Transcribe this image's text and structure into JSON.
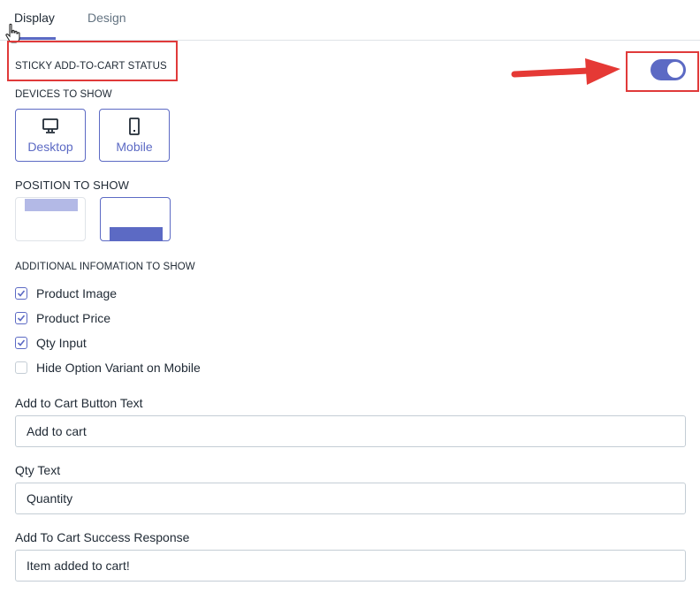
{
  "tabs": [
    {
      "label": "Display",
      "active": true
    },
    {
      "label": "Design",
      "active": false
    }
  ],
  "status": {
    "heading": "STICKY ADD-TO-CART STATUS",
    "enabled": true
  },
  "devices": {
    "heading": "DEVICES TO SHOW",
    "options": [
      {
        "label": "Desktop",
        "icon": "desktop-icon",
        "selected": true
      },
      {
        "label": "Mobile",
        "icon": "mobile-icon",
        "selected": true
      }
    ]
  },
  "position": {
    "heading": "POSITION TO SHOW",
    "options": [
      {
        "value": "top",
        "selected": false
      },
      {
        "value": "bottom",
        "selected": true
      }
    ]
  },
  "additional_info": {
    "heading": "ADDITIONAL INFOMATION TO SHOW",
    "options": [
      {
        "label": "Product Image",
        "checked": true
      },
      {
        "label": "Product Price",
        "checked": true
      },
      {
        "label": "Qty Input",
        "checked": true
      },
      {
        "label": "Hide Option Variant on Mobile",
        "checked": false
      }
    ]
  },
  "fields": [
    {
      "label": "Add to Cart Button Text",
      "value": "Add to cart"
    },
    {
      "label": "Qty Text",
      "value": "Quantity"
    },
    {
      "label": "Add To Cart Success Response",
      "value": "Item added to cart!"
    }
  ],
  "colors": {
    "accent": "#5c6ac4",
    "annotation": "#e03a3a",
    "accent_light": "#b3b9e6"
  }
}
